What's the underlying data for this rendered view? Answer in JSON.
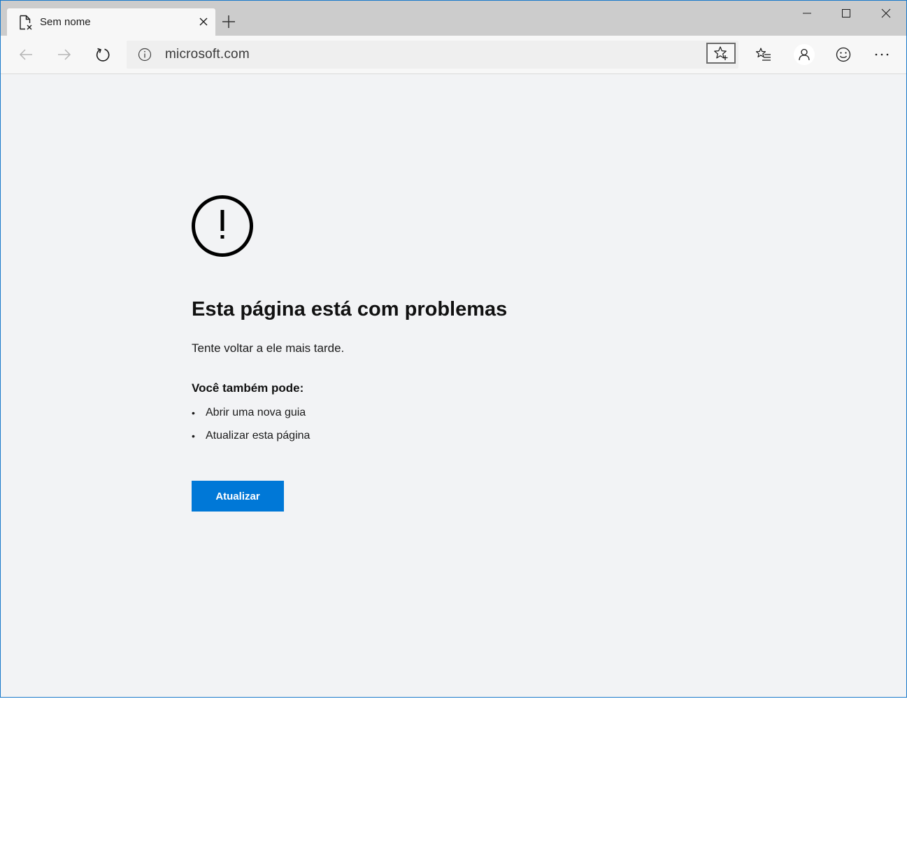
{
  "tab": {
    "title": "Sem nome",
    "icon": "broken-page-icon"
  },
  "toolbar": {
    "url": "microsoft.com"
  },
  "error": {
    "icon": "exclamation-circle-icon",
    "title": "Esta página está com problemas",
    "subtitle": "Tente voltar a ele mais tarde.",
    "also_heading": "Você também pode:",
    "suggestions": [
      "Abrir uma nova guia",
      "Atualizar esta página"
    ],
    "button_label": "Atualizar",
    "button_color": "#0078d7"
  },
  "colors": {
    "window_border": "#1979ca",
    "page_background": "#f2f3f5",
    "tabstrip_background": "#cccccc"
  }
}
